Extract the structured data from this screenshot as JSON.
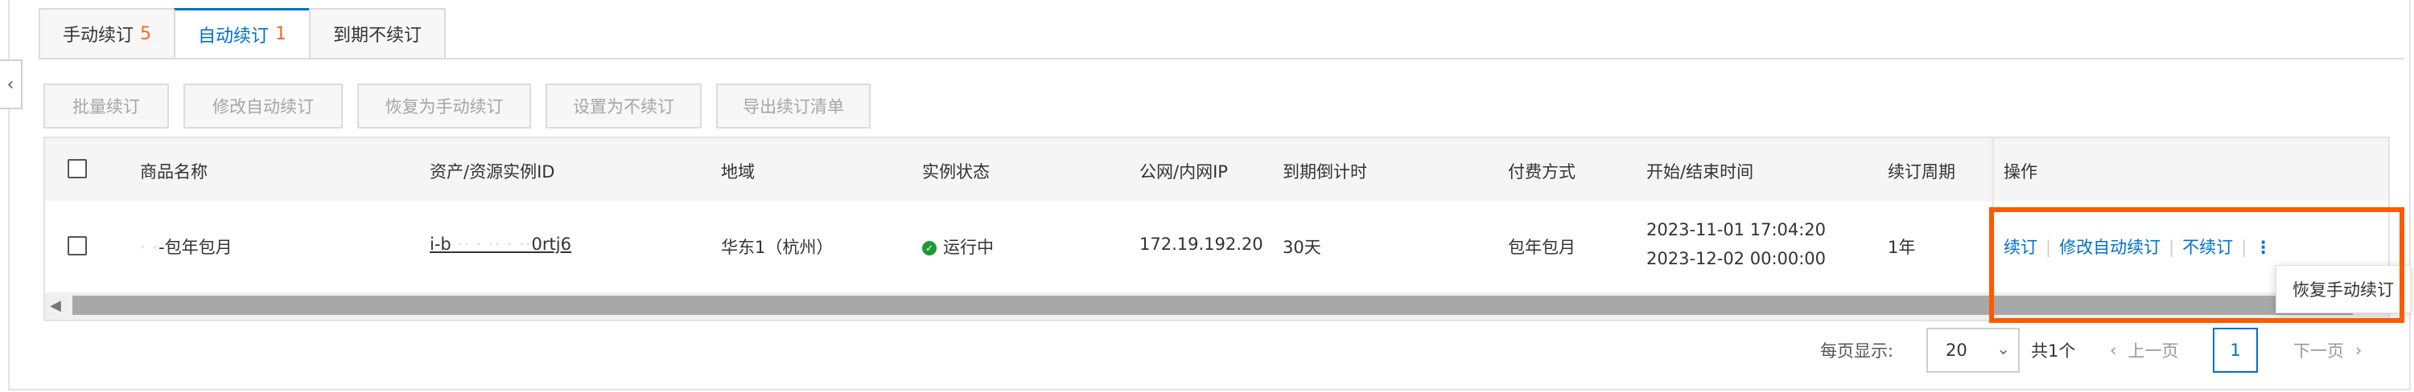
{
  "tabs": [
    {
      "label": "手动续订",
      "count": "5"
    },
    {
      "label": "自动续订",
      "count": "1"
    },
    {
      "label": "到期不续订",
      "count": ""
    }
  ],
  "collapse_icon": "chevron-left-icon",
  "toolbar": {
    "batch_renew": "批量续订",
    "modify_auto": "修改自动续订",
    "restore_manual": "恢复为手动续订",
    "set_no_renew": "设置为不续订",
    "export": "导出续订清单"
  },
  "table": {
    "headers": {
      "product": "商品名称",
      "instance_id": "资产/资源实例ID",
      "region": "地域",
      "status": "实例状态",
      "ip": "公网/内网IP",
      "countdown": "到期倒计时",
      "payment": "付费方式",
      "time": "开始/结束时间",
      "period": "续订周期",
      "actions": "操作"
    },
    "row": {
      "product_blur": "·     ·",
      "product_suffix": "-包年包月",
      "instance_prefix": "i-b",
      "instance_blur": "  ·· ·  ·· ·  ··",
      "instance_suffix": "0rtj6",
      "region": "华东1（杭州）",
      "status": "运行中",
      "ip": "172.19.192.20",
      "countdown": "30天",
      "payment": "包年包月",
      "start_time": "2023-11-01 17:04:20",
      "end_time": "2023-12-02 00:00:00",
      "period": "1年",
      "actions": {
        "renew": "续订",
        "modify_auto": "修改自动续订",
        "no_renew": "不续订",
        "more_icon": "vertical-ellipsis-icon"
      }
    },
    "dropdown_item": "恢复手动续订"
  },
  "pager": {
    "per_page_label": "每页显示:",
    "per_page_value": "20",
    "total": "共1个",
    "prev": "上一页",
    "current": "1",
    "next": "下一页"
  },
  "colors": {
    "accent": "#0070cc",
    "count": "#f56c1f",
    "status_ok": "#1e9b35",
    "highlight": "#ff5a00"
  }
}
